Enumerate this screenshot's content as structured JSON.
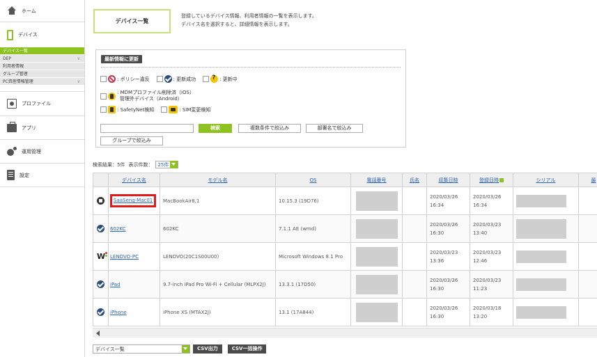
{
  "sidebar": {
    "home": "ホーム",
    "device": "デバイス",
    "sub_items": [
      {
        "label": "デバイス一覧",
        "chevron": ""
      },
      {
        "label": "DEP",
        "chevron": "∨"
      },
      {
        "label": "利用者情報",
        "chevron": ""
      },
      {
        "label": "グループ管理",
        "chevron": ""
      },
      {
        "label": "PC資産情報管理",
        "chevron": "∨"
      }
    ],
    "profile": "プロファイル",
    "app": "アプリ",
    "ops": "運用管理",
    "settings": "設定"
  },
  "page": {
    "title": "デバイス一覧",
    "desc_line1": "登録しているデバイス情報、利用者情報の一覧を表示します。",
    "desc_line2": "デバイス名を選択すると、詳細情報を表示します。"
  },
  "filter": {
    "refresh_label": "最新情報に更新",
    "status": {
      "policy": ": ポリシー違反",
      "success": ": 更新成功",
      "updating": ": 更新中",
      "mdm_line1": ": MDMプロファイル削除済（iOS）",
      "mdm_line2": "管理外デバイス（Android）",
      "safetynet": ": SafetyNet検知",
      "sim": ": SIM変更検知"
    },
    "search_value": "",
    "search_label": "検索",
    "filter_conditions": "複数条件で絞込み",
    "filter_department": "部署名で絞込み",
    "filter_group": "グループで絞込み"
  },
  "results": {
    "count_text": "検索結果：5件",
    "per_page_label": "表示件数：",
    "per_page_value": "25件"
  },
  "table": {
    "columns": [
      "デバイス名",
      "モデル名",
      "OS",
      "電話番号",
      "氏名",
      "収集日時",
      "登録日時",
      "シリアル",
      "最"
    ],
    "rows": [
      {
        "icon": "mac-icon",
        "name": "SaaSeng-Mac01",
        "model": "MacBookAir8,1",
        "os": "10.15.3 (19D76)",
        "collected": "2020/03/26 16:34",
        "registered": "2020/03/26 16:34"
      },
      {
        "icon": "check-icon",
        "name": "602KC",
        "model": "602KC",
        "os": "7.1.1 AE (wmd)",
        "collected": "2020/03/26 16:30",
        "registered": "2020/03/23 13:40"
      },
      {
        "icon": "windows-icon",
        "name": "LENOVO-PC",
        "model": "LENOVO(20C1S00U00)",
        "os": "Microsoft Windows 8.1 Pro",
        "collected": "2020/03/23 13:36",
        "registered": "2020/03/23 12:46"
      },
      {
        "icon": "check-icon",
        "name": "iPad",
        "model": "9.7-inch iPad Pro Wi-Fi + Cellular (MLPX2J)",
        "os": "13.3.1 (17D50)",
        "collected": "2020/03/26 16:30",
        "registered": "2020/03/23 11:23"
      },
      {
        "icon": "check-icon",
        "name": "iPhone",
        "model": "iPhone XS (MTAX2J)",
        "os": "13.1 (17A844)",
        "collected": "2020/03/26 16:30",
        "registered": "2020/03/18 13:20"
      }
    ]
  },
  "bottom": {
    "view_select_value": "デバイス一覧",
    "csv_export": "CSV出力",
    "csv_bulk": "CSV一括操作"
  }
}
